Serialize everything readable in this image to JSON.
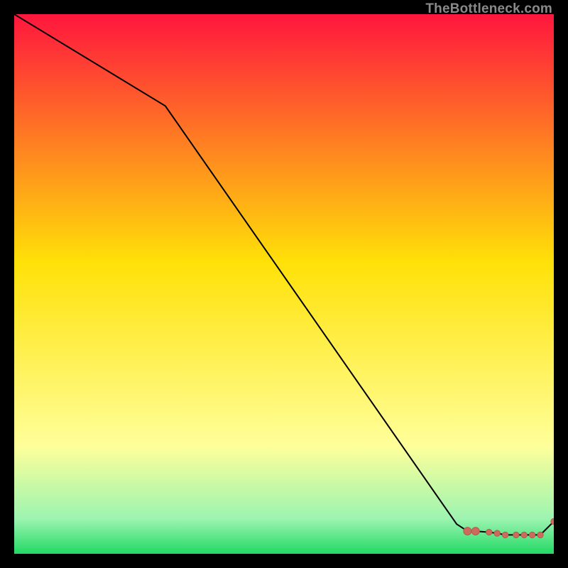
{
  "watermark": {
    "text": "TheBottleneck.com"
  },
  "colors": {
    "line": "#000000",
    "marker_fill": "#cc6a5c",
    "marker_edge": "#b85a4d",
    "top": "#ff163e",
    "mid": "#ffe108",
    "yellow_pale": "#ffff9a",
    "green_pale": "#9cf4b0",
    "green": "#22d965",
    "background": "#000000"
  },
  "chart_data": {
    "type": "line",
    "title": "",
    "xlabel": "",
    "ylabel": "",
    "xlim": [
      0,
      100
    ],
    "ylim": [
      0,
      100
    ],
    "x": [
      0,
      28,
      82,
      84,
      85.5,
      88,
      89.5,
      91,
      93,
      94.5,
      96,
      97.5,
      100
    ],
    "values": [
      100,
      83,
      5.5,
      4.2,
      4.2,
      4.0,
      3.8,
      3.5,
      3.5,
      3.5,
      3.5,
      3.5,
      6.0
    ],
    "markers_index_start": 3,
    "annotations": []
  }
}
